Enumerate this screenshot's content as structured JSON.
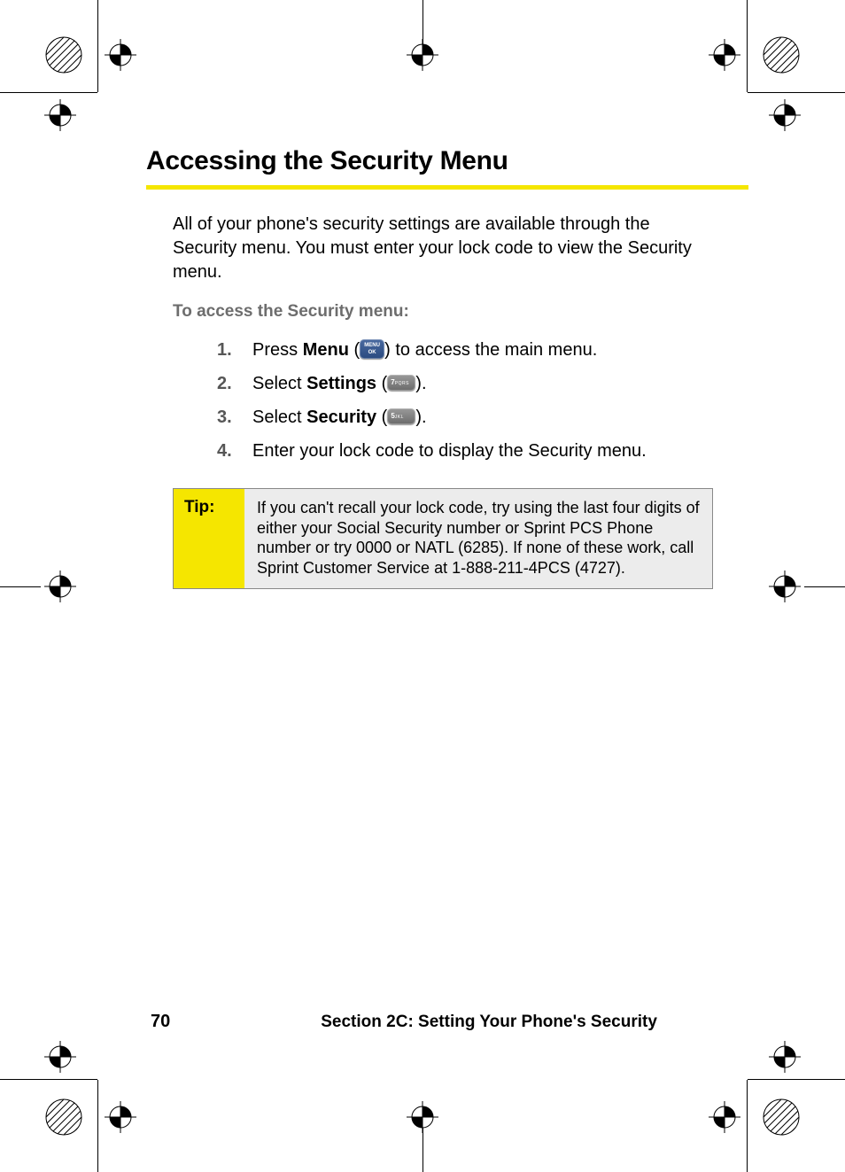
{
  "heading": "Accessing the Security Menu",
  "intro": "All of your phone's security settings are available through the Security menu. You must enter your lock code to view the Security menu.",
  "subhead": "To access the Security menu:",
  "steps": {
    "s1_pre": "Press ",
    "s1_bold": "Menu",
    "s1_post": " to access the main menu.",
    "s2_pre": "Select ",
    "s2_bold": "Settings",
    "s2_post": ".",
    "s3_pre": "Select ",
    "s3_bold": "Security",
    "s3_post": ".",
    "s4": "Enter your lock code to display the Security menu."
  },
  "keys": {
    "menu_line1": "MENU",
    "menu_line2": "OK",
    "num7": "7",
    "num7_letters": "PQRS",
    "num5": "5",
    "num5_letters": "JKL"
  },
  "tip": {
    "label": "Tip:",
    "body": "If you can't recall your lock code, try using the last four digits of either your Social Security number or Sprint PCS Phone number or try 0000 or NATL (6285). If none of these work, call Sprint Customer Service at 1-888-211-4PCS (4727)."
  },
  "footer": {
    "page": "70",
    "section": "Section 2C: Setting Your Phone's Security"
  }
}
